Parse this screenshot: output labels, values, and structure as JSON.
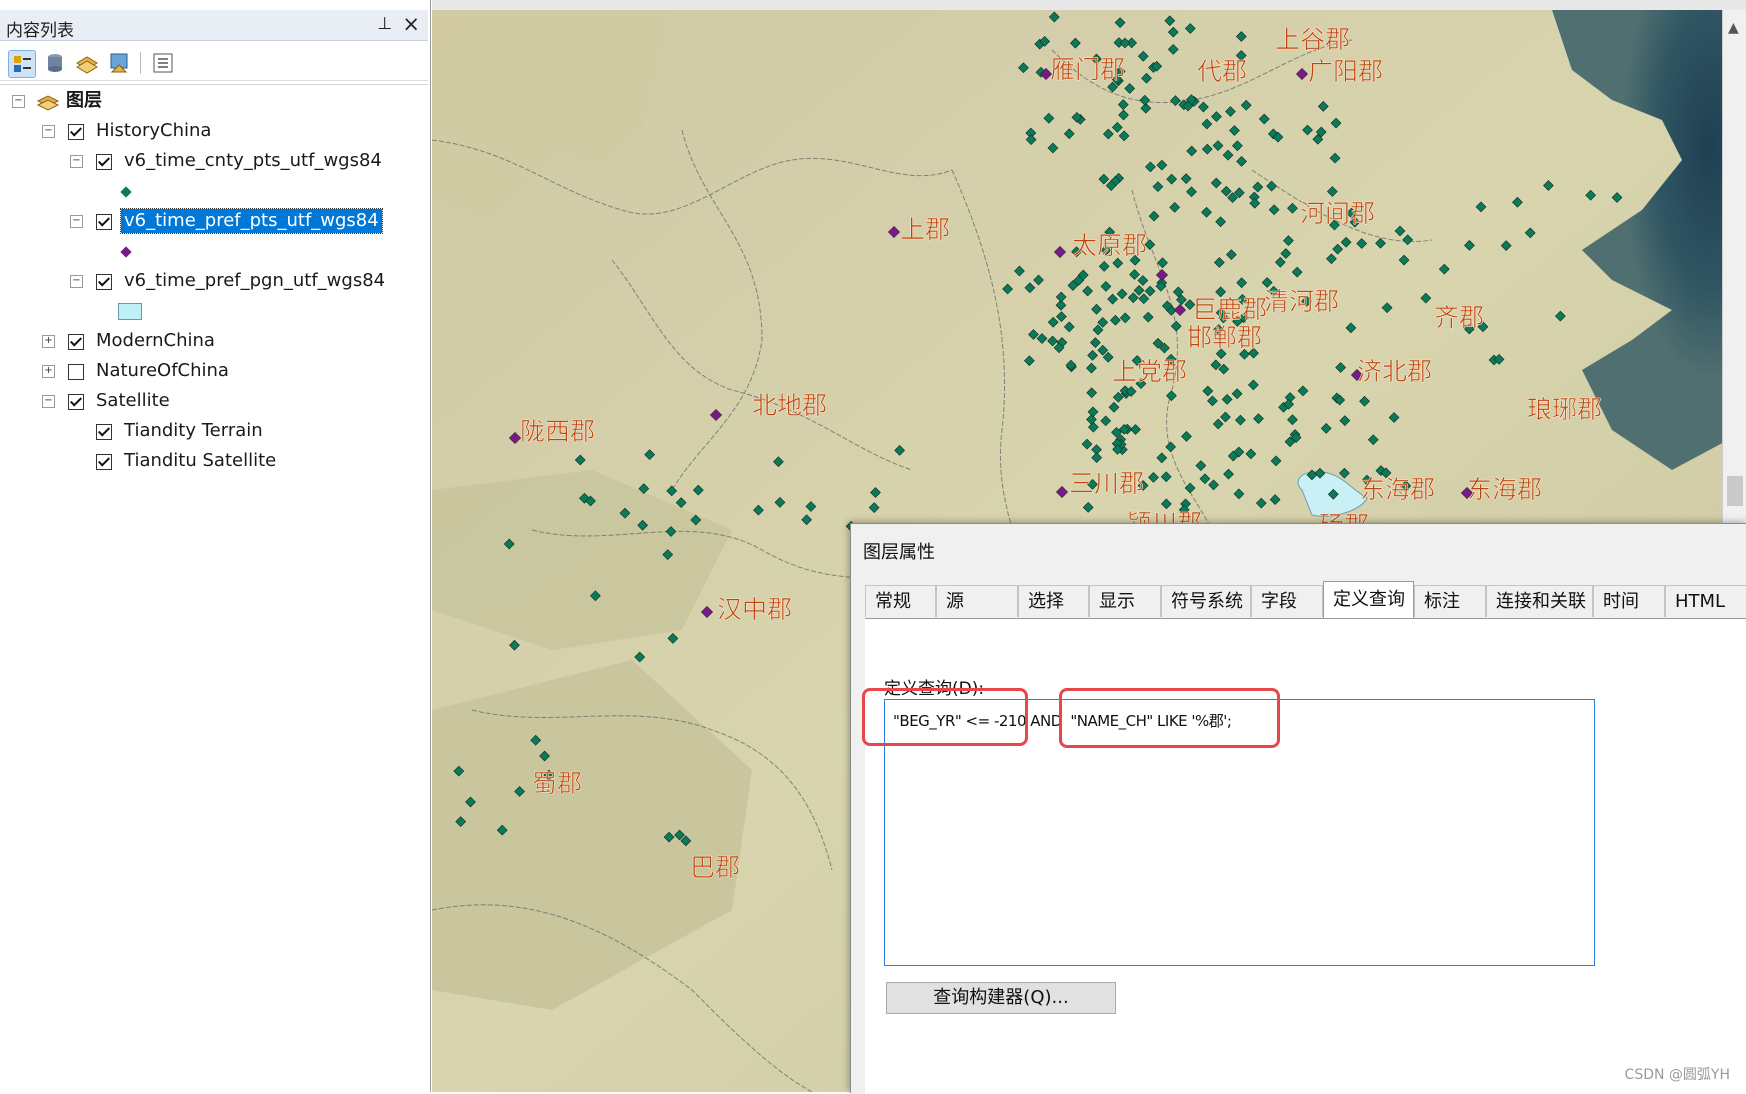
{
  "toc": {
    "title": "内容列表",
    "pin_icon": "pin-icon",
    "close_icon": "close-icon",
    "tree": [
      {
        "label": "图层"
      },
      {
        "label": "HistoryChina"
      },
      {
        "label": "v6_time_cnty_pts_utf_wgs84"
      },
      {
        "label": "v6_time_pref_pts_utf_wgs84"
      },
      {
        "label": "v6_time_pref_pgn_utf_wgs84"
      },
      {
        "label": "ModernChina"
      },
      {
        "label": "NatureOfChina"
      },
      {
        "label": "Satellite"
      },
      {
        "label": "Tiandity Terrain"
      },
      {
        "label": "Tianditu Satellite"
      }
    ]
  },
  "map": {
    "labels": [
      "上谷郡",
      "雁门郡",
      "代郡",
      "广阳郡",
      "上郡",
      "太原郡",
      "河间郡",
      "巨鹿郡",
      "清河郡",
      "齐郡",
      "邯郸郡",
      "上党郡",
      "济北郡",
      "琅琊郡",
      "北地郡",
      "陇西郡",
      "三川郡",
      "东海郡",
      "东海郡",
      "颍川郡",
      "砀郡",
      "汉中郡",
      "蜀郡",
      "巴郡"
    ],
    "label_color": "#c0420e",
    "point_color": "#0a7a58",
    "pref_point_color": "#7a1a8a"
  },
  "dialog": {
    "title": "图层属性",
    "tabs": [
      "常规",
      "源",
      "选择",
      "显示",
      "符号系统",
      "字段",
      "定义查询",
      "标注",
      "连接和关联",
      "时间",
      "HTML 弹"
    ],
    "active_tab": "定义查询",
    "query_label": "定义查询(D):",
    "query_text": "\"BEG_YR\" <= -210 AND  \"NAME_CH\" LIKE '%郡';",
    "query_builder": "查询构建器(Q)..."
  },
  "watermark": "CSDN @圆弧YH"
}
